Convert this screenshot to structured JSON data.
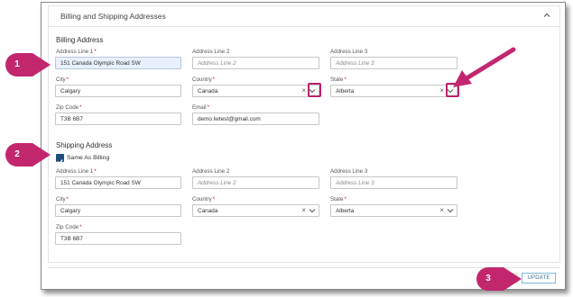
{
  "panel": {
    "title": "Billing and Shipping Addresses"
  },
  "billing": {
    "heading": "Billing Address",
    "address1": {
      "label": "Address Line 1",
      "value": "151 Canada Olympic Road SW"
    },
    "address2": {
      "label": "Address Line 2",
      "placeholder": "Address Line 2"
    },
    "address3": {
      "label": "Address Line 3",
      "placeholder": "Address Line 3"
    },
    "city": {
      "label": "City",
      "value": "Calgary"
    },
    "country": {
      "label": "Country",
      "value": "Canada"
    },
    "state": {
      "label": "State",
      "value": "Alberta"
    },
    "zip": {
      "label": "Zip Code",
      "value": "T3B 6B7"
    },
    "email": {
      "label": "Email",
      "value": "demo.lwtest@gmail.com"
    }
  },
  "shipping": {
    "heading": "Shipping Address",
    "same_as_billing": {
      "label": "Same As Billing",
      "checked": true
    },
    "address1": {
      "label": "Address Line 1",
      "value": "151 Canada Olympic Road SW"
    },
    "address2": {
      "label": "Address Line 2",
      "placeholder": "Address Line 2"
    },
    "address3": {
      "label": "Address Line 3",
      "placeholder": "Address Line 3"
    },
    "city": {
      "label": "City",
      "value": "Calgary"
    },
    "country": {
      "label": "Country",
      "value": "Canada"
    },
    "state": {
      "label": "State",
      "value": "Alberta"
    },
    "zip": {
      "label": "Zip Code",
      "value": "T3B 6B7"
    }
  },
  "required_mark": "*",
  "clear_glyph": "×",
  "update_label": "UPDATE",
  "callouts": [
    "1",
    "2",
    "3"
  ],
  "colors": {
    "callout": "#c2276e",
    "highlight": "#b8236b",
    "checkbox": "#1f4e7a",
    "update_border": "#7fb7d6"
  }
}
